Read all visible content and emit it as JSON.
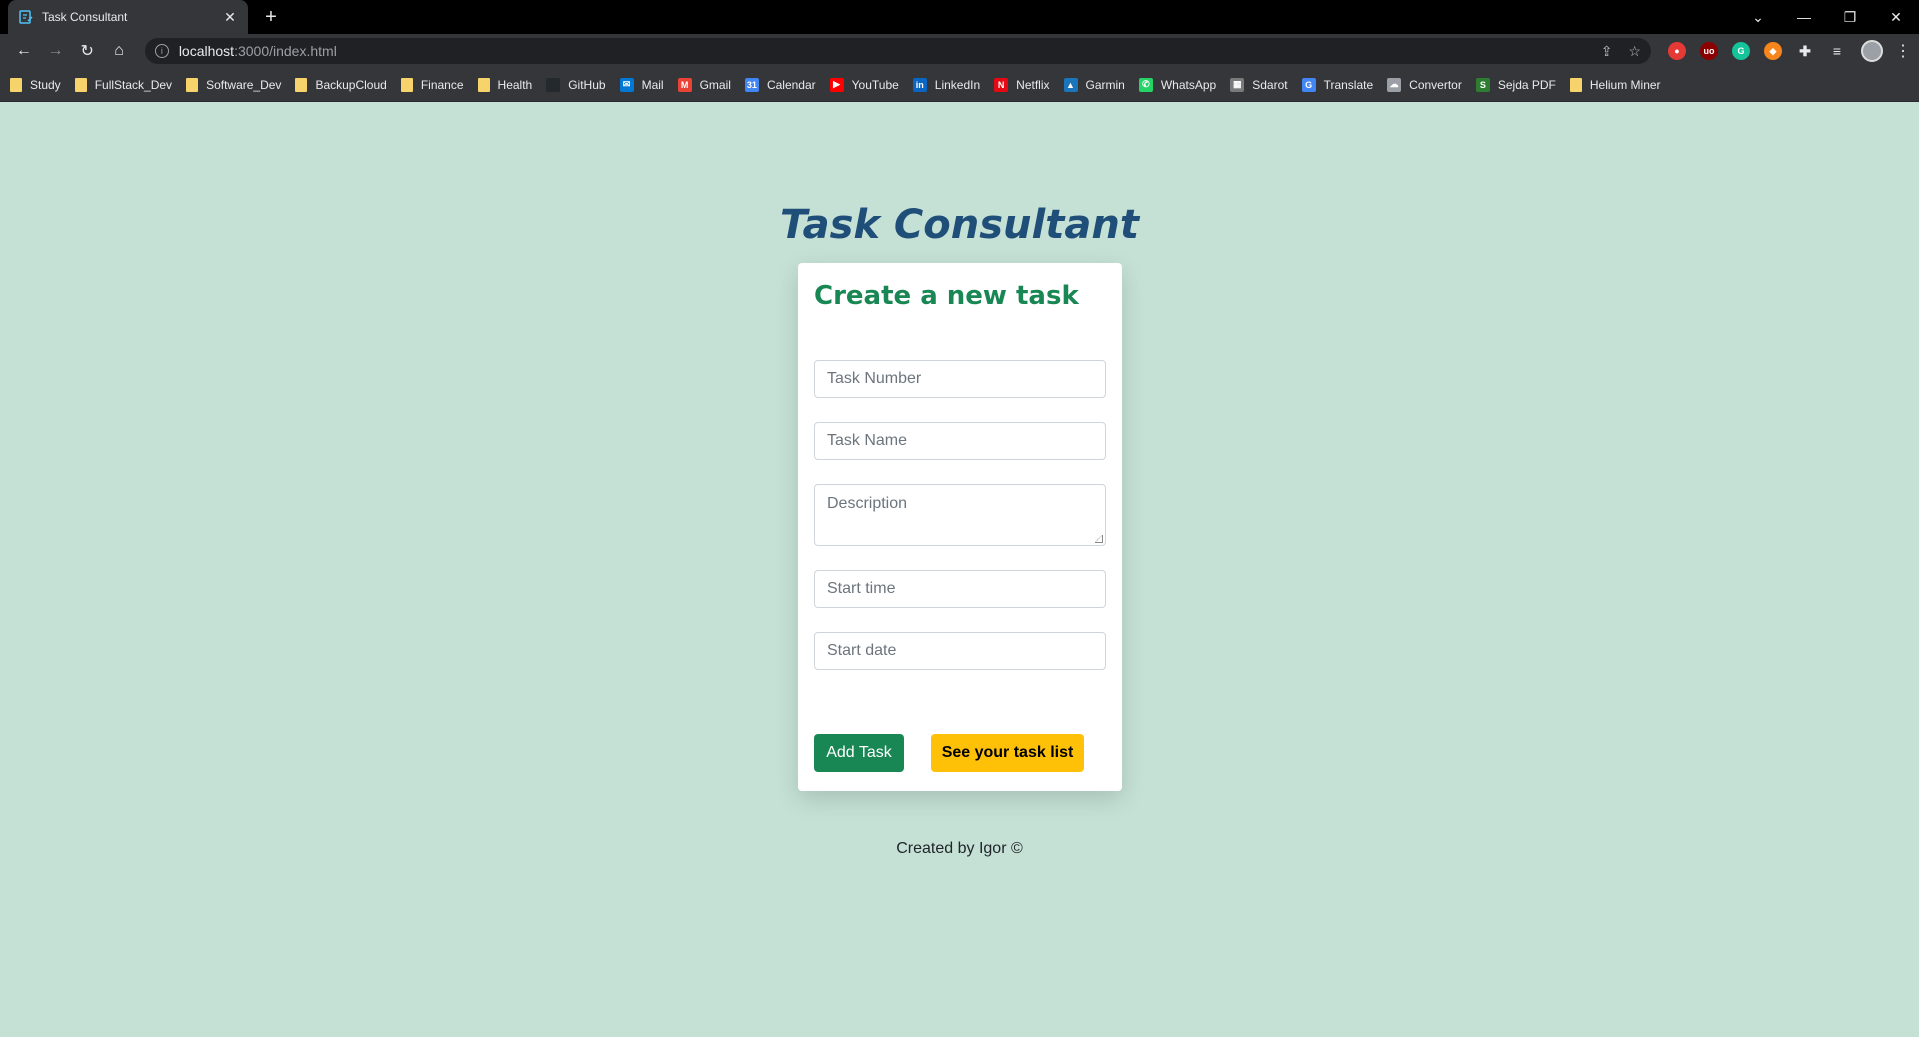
{
  "browser": {
    "tab_title": "Task Consultant",
    "url_host": "localhost",
    "url_path": ":3000/index.html",
    "bookmarks": [
      {
        "label": "Study",
        "icon": "folder-icon"
      },
      {
        "label": "FullStack_Dev",
        "icon": "folder-icon"
      },
      {
        "label": "Software_Dev",
        "icon": "folder-icon"
      },
      {
        "label": "BackupCloud",
        "icon": "folder-icon"
      },
      {
        "label": "Finance",
        "icon": "folder-icon"
      },
      {
        "label": "Health",
        "icon": "folder-icon"
      },
      {
        "label": "GitHub",
        "icon": "github-icon"
      },
      {
        "label": "Mail",
        "icon": "mail-icon"
      },
      {
        "label": "Gmail",
        "icon": "gmail-icon"
      },
      {
        "label": "Calendar",
        "icon": "calendar-icon"
      },
      {
        "label": "YouTube",
        "icon": "youtube-icon"
      },
      {
        "label": "LinkedIn",
        "icon": "linkedin-icon"
      },
      {
        "label": "Netflix",
        "icon": "netflix-icon"
      },
      {
        "label": "Garmin",
        "icon": "garmin-icon"
      },
      {
        "label": "WhatsApp",
        "icon": "whatsapp-icon"
      },
      {
        "label": "Sdarot",
        "icon": "sdarot-icon"
      },
      {
        "label": "Translate",
        "icon": "translate-icon"
      },
      {
        "label": "Convertor",
        "icon": "convertor-icon"
      },
      {
        "label": "Sejda PDF",
        "icon": "sejda-icon"
      },
      {
        "label": "Helium Miner",
        "icon": "folder-icon"
      }
    ]
  },
  "app": {
    "title": "Task Consultant",
    "card_title": "Create a new task",
    "fields": {
      "task_number_placeholder": "Task Number",
      "task_name_placeholder": "Task Name",
      "description_placeholder": "Description",
      "start_time_placeholder": "Start time",
      "start_date_placeholder": "Start date"
    },
    "add_button": "Add Task",
    "list_button": "See your task list",
    "footer": "Created by Igor ©"
  },
  "colors": {
    "page_bg": "#c5e1d6",
    "title": "#1f4e79",
    "card_title": "#198754",
    "add_button": "#198754",
    "list_button": "#ffc107"
  }
}
